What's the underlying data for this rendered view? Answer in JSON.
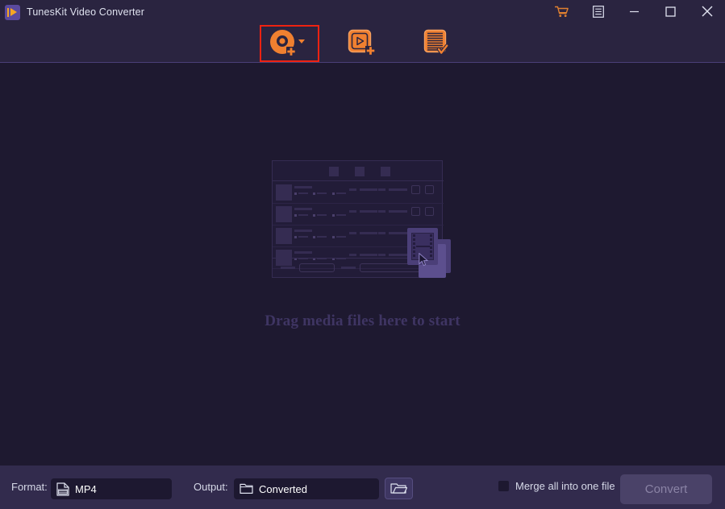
{
  "window": {
    "title": "TunesKit Video Converter",
    "logo_icon": "tuneskit-play-logo",
    "controls": [
      {
        "name": "cart-icon",
        "glyph": "shopping-cart"
      },
      {
        "name": "menu-icon",
        "glyph": "list-menu"
      },
      {
        "name": "minimize-icon",
        "glyph": "minimize"
      },
      {
        "name": "maximize-icon",
        "glyph": "maximize"
      },
      {
        "name": "close-icon",
        "glyph": "close"
      }
    ]
  },
  "toolbar": {
    "tabs": [
      {
        "id": "add-disc",
        "icon": "disc-add-icon",
        "label": "Add DVD/Disc",
        "selected": true,
        "has_dropdown": true
      },
      {
        "id": "add-file",
        "icon": "video-add-icon",
        "label": "Add Files",
        "selected": false,
        "has_dropdown": false
      },
      {
        "id": "add-list",
        "icon": "list-check-icon",
        "label": "Converted List",
        "selected": false,
        "has_dropdown": false
      }
    ],
    "highlight_color": "#ee2211",
    "accent_color": "#f08030"
  },
  "main": {
    "drag_prompt": "Drag media files here to start",
    "illustration_name": "drag-drop-illustration"
  },
  "bottom": {
    "format_label": "Format:",
    "format_value": "MP4",
    "format_icon": "file-video-icon",
    "output_label": "Output:",
    "output_value": "Converted",
    "output_icon": "folder-icon",
    "browse_icon": "open-folder-icon",
    "merge_label": "Merge all into one file",
    "merge_checked": false,
    "convert_label": "Convert",
    "convert_enabled": false
  }
}
